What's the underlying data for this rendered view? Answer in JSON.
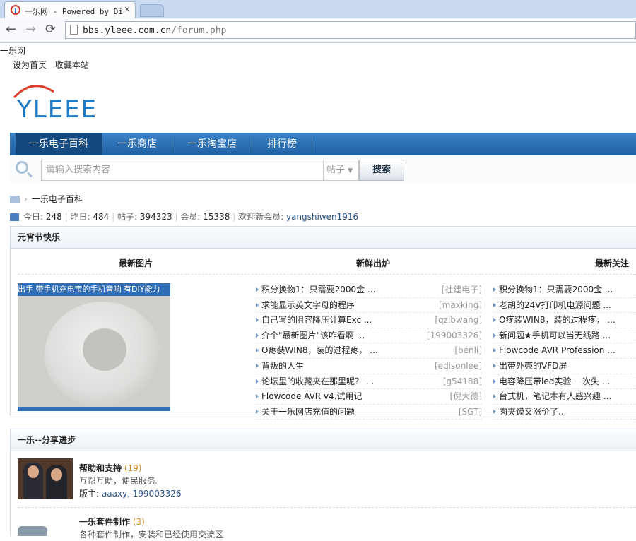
{
  "browser": {
    "tab_title": "一乐网 - Powered by Dis",
    "tab_close": "×",
    "back": "←",
    "forward": "→",
    "reload": "⟳",
    "url_host": "bbs.yleee.com.cn",
    "url_path": "/forum.php"
  },
  "page": {
    "title": "一乐网",
    "top_links": [
      "设为首页",
      "收藏本站"
    ],
    "logo_text": "YLEEE"
  },
  "nav": {
    "items": [
      "一乐电子百科",
      "一乐商店",
      "一乐淘宝店",
      "排行榜"
    ],
    "active": 0
  },
  "search": {
    "placeholder": "请输入搜索内容",
    "scope": "帖子",
    "button": "搜索"
  },
  "breadcrumb": {
    "current": "一乐电子百科"
  },
  "stats": {
    "today_label": "今日:",
    "today": "248",
    "yesterday_label": "昨日:",
    "yesterday": "484",
    "posts_label": "帖子:",
    "posts": "394323",
    "members_label": "会员:",
    "members": "15338",
    "welcome_label": "欢迎新会员:",
    "newest_member": "yangshiwen1916"
  },
  "section1": {
    "title": "元宵节快乐",
    "col_images": "最新图片",
    "col_new": "新鲜出炉",
    "col_hot": "最新关注",
    "image_caption": "出手 带手机充电宝的手机音响 有DIY能力",
    "new_posts": [
      {
        "title": "积分换物1：只需要2000金 ...",
        "author": "[社建电子]"
      },
      {
        "title": "求能显示英文字母的程序",
        "author": "[maxking]"
      },
      {
        "title": "自己写的阻容降压计算Exc ...",
        "author": "[qzlbwang]"
      },
      {
        "title": "介个\"最新图片\"该咋看啊 ...",
        "author": "[199003326]"
      },
      {
        "title": "O疼装WIN8，装的过程疼， ...",
        "author": "[benli]"
      },
      {
        "title": "背叛的人生",
        "author": "[edisonlee]"
      },
      {
        "title": "论坛里的收藏夹在那里呢？ ...",
        "author": "[g54188]"
      },
      {
        "title": "Flowcode AVR v4.试用记",
        "author": "[倪大德]"
      },
      {
        "title": "关于一乐网店充值的问题",
        "author": "[SGT]"
      }
    ],
    "hot_posts": [
      "积分换物1：只需要2000金 ...",
      "老胡的24V打印机电源问题 ...",
      "O疼装WIN8，装的过程疼， ...",
      "新问题★手机可以当无线路 ...",
      "Flowcode AVR Profession ...",
      "出带外壳的VFD屏",
      "电容降压带led实验 一次失 ...",
      "台式机，笔记本有人感兴趣 ...",
      "肉夹馍又涨价了..."
    ]
  },
  "section2": {
    "title": "一乐--分享进步",
    "forums": [
      {
        "name": "帮助和支持",
        "count": "(19)",
        "desc": "互帮互助，便民服务。",
        "mod_label": "版主:",
        "mods": "aaaxy, 199003326"
      },
      {
        "name": "一乐套件制作",
        "count": "(3)",
        "desc": "各种套件制作，安装和已经使用交流区"
      }
    ]
  }
}
